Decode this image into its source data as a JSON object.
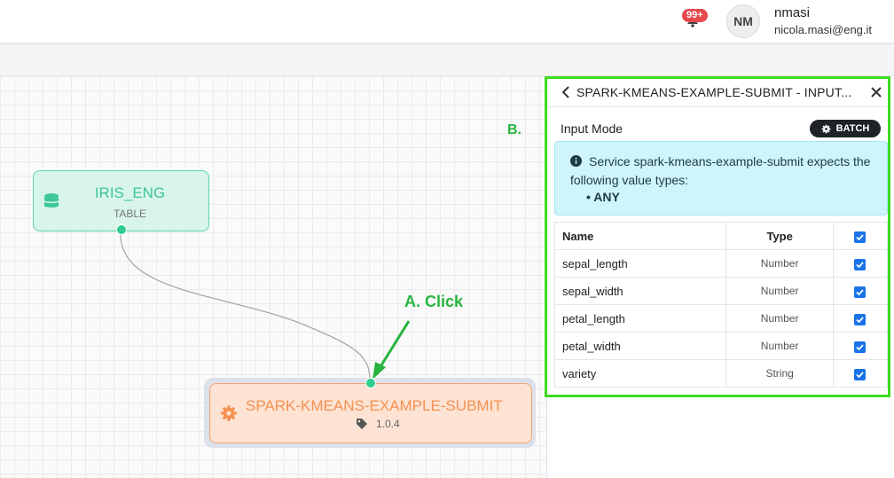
{
  "header": {
    "notification_count": "99+",
    "avatar_initials": "NM",
    "username": "nmasi",
    "email": "nicola.masi@eng.it"
  },
  "canvas": {
    "table_node": {
      "title": "IRIS_ENG",
      "subtitle": "TABLE"
    },
    "service_node": {
      "title": "SPARK-KMEANS-EXAMPLE-SUBMIT",
      "version": "1.0.4"
    },
    "annotation_a": "A. Click",
    "annotation_b": "B."
  },
  "panel": {
    "title": "SPARK-KMEANS-EXAMPLE-SUBMIT - INPUT...",
    "input_mode_label": "Input Mode",
    "input_mode_value": "BATCH",
    "info_text": "Service spark-kmeans-example-submit expects the following value types:",
    "info_list_item": "ANY",
    "table": {
      "headers": {
        "name": "Name",
        "type": "Type"
      },
      "rows": [
        {
          "name": "sepal_length",
          "type": "Number",
          "checked": true
        },
        {
          "name": "sepal_width",
          "type": "Number",
          "checked": true
        },
        {
          "name": "petal_length",
          "type": "Number",
          "checked": true
        },
        {
          "name": "petal_width",
          "type": "Number",
          "checked": true
        },
        {
          "name": "variety",
          "type": "String",
          "checked": true
        }
      ]
    }
  },
  "colors": {
    "table_node": "#3cc696",
    "service_node": "#f59152",
    "annotation": "#28b43f",
    "checkbox": "#1a73e8"
  },
  "icons": {
    "notification": "bell-icon",
    "table_node": "database-icon",
    "service_node": "gear-icon",
    "version": "tag-icon",
    "back": "chevron-left-icon",
    "close": "close-icon",
    "batch": "gear-icon",
    "info": "info-icon"
  }
}
